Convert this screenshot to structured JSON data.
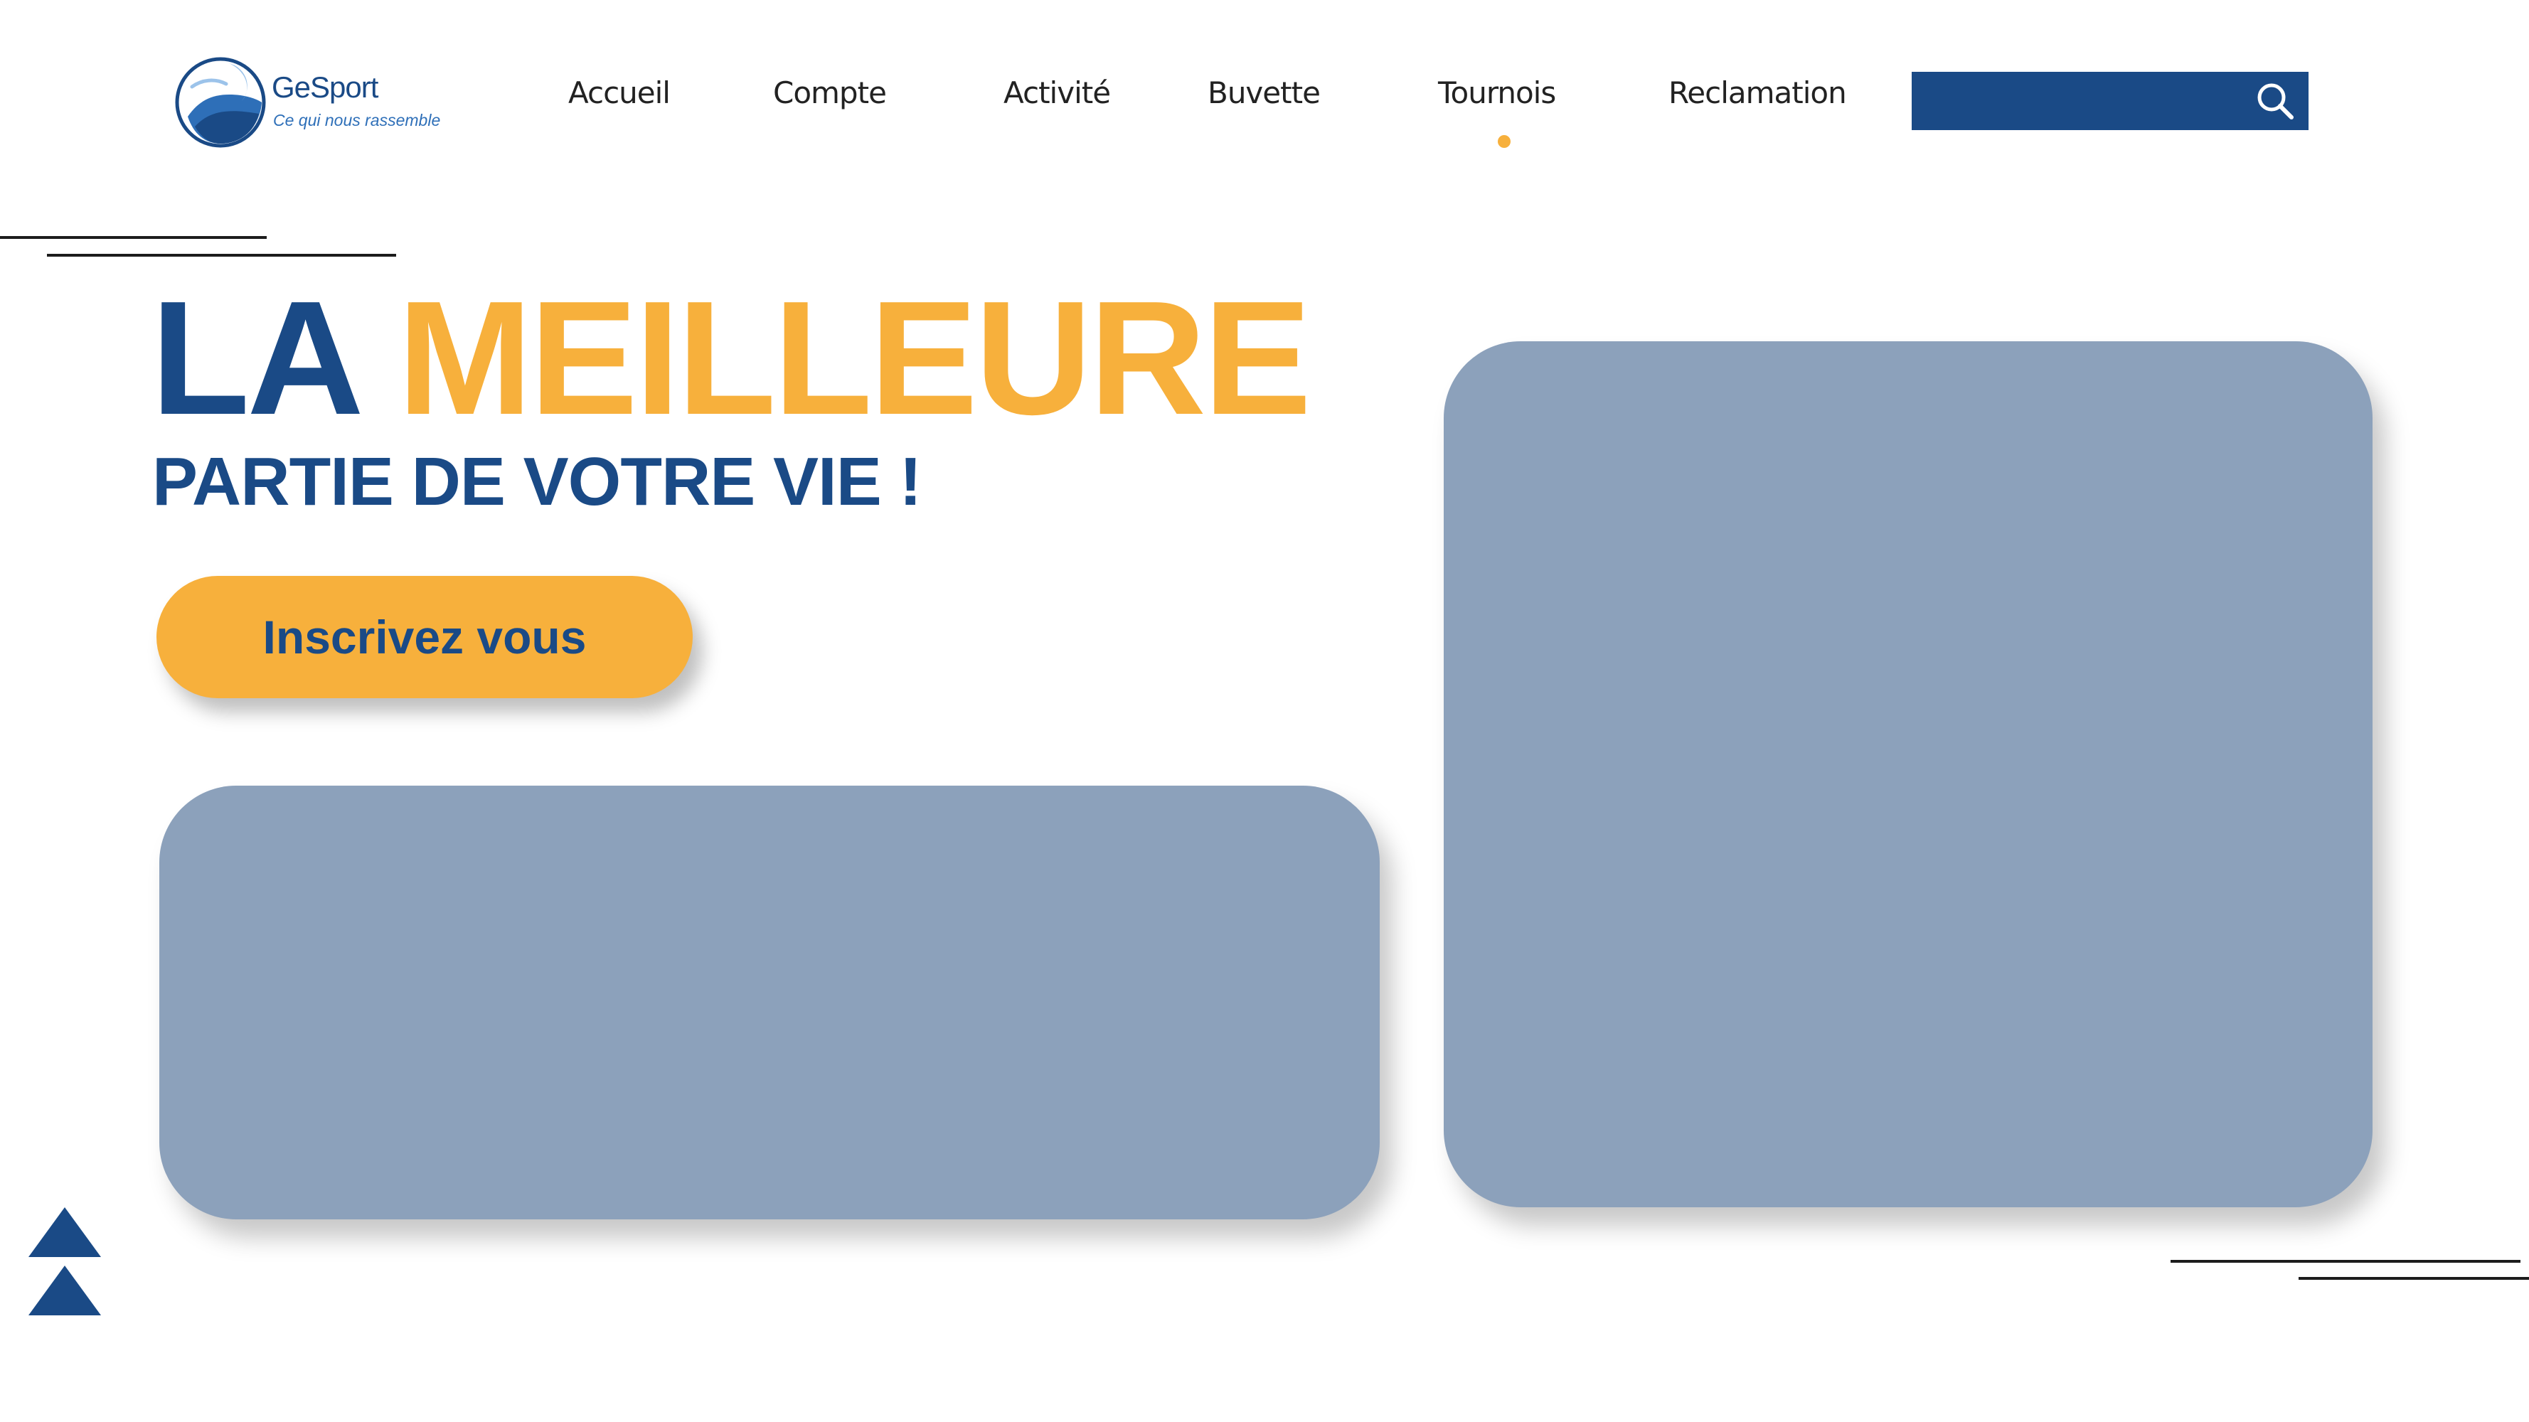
{
  "brand": {
    "name": "GeSport",
    "tagline": "Ce qui nous rassemble",
    "logo_icon": "wave-circle-logo-icon"
  },
  "nav": {
    "items": [
      {
        "label": "Accueil"
      },
      {
        "label": "Compte"
      },
      {
        "label": "Activité"
      },
      {
        "label": "Buvette"
      },
      {
        "label": "Tournois",
        "active": true
      },
      {
        "label": "Reclamation"
      }
    ]
  },
  "search": {
    "value": "",
    "icon": "search-icon"
  },
  "hero": {
    "title_part1": "LA",
    "title_part2": "MEILLEURE",
    "subtitle": "PARTIE DE VOTRE VIE !",
    "cta_label": "Inscrivez vous"
  },
  "colors": {
    "primary_blue": "#1a4a86",
    "accent_orange": "#f7b03c",
    "placeholder_card": "#8ca1bb",
    "text_dark": "#222222",
    "background": "#ffffff"
  },
  "icons": {
    "scroll_up": "triangle-up-icon"
  }
}
